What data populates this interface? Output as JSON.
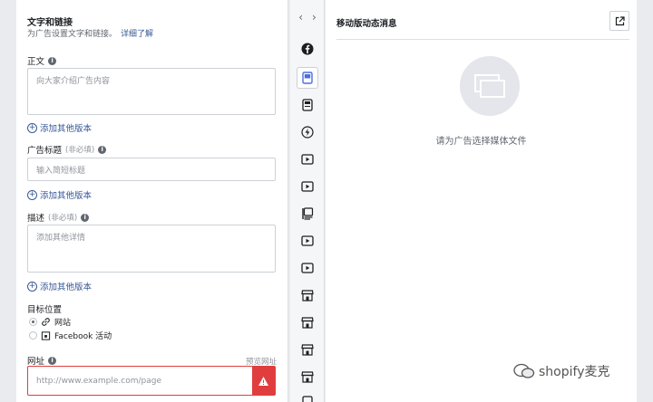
{
  "left": {
    "title": "文字和链接",
    "subtitle": "为广告设置文字和链接。",
    "learn_more": "详细了解",
    "body_label": "正文",
    "body_placeholder": "向大家介绍广告内容",
    "add_version": "添加其他版本",
    "headline_label": "广告标题",
    "headline_optional": "(非必填)",
    "headline_placeholder": "输入简短标题",
    "desc_label": "描述",
    "desc_optional": "(非必填)",
    "desc_placeholder": "添加其他详情",
    "destination_label": "目标位置",
    "dest_website": "网站",
    "dest_facebook": "Facebook 活动",
    "url_label": "网址",
    "preview_url": "预览网址",
    "url_placeholder": "http://www.example.com/page"
  },
  "rail": {
    "prev": "‹",
    "next": "›",
    "icons": [
      "facebook-icon",
      "feed-icon",
      "story-icon",
      "instant-article-icon",
      "video-icon",
      "video-feed-icon",
      "right-column-icon",
      "in-stream-video-icon",
      "suggested-video-icon",
      "marketplace-icon",
      "marketplace-icon-2",
      "marketplace-icon-3",
      "marketplace-icon-4",
      "partial-icon"
    ]
  },
  "right": {
    "title": "移动版动态消息",
    "media_prompt": "请为广告选择媒体文件"
  },
  "watermark": "shopify麦克",
  "colors": {
    "link": "#385898",
    "error": "#e03e3e",
    "active_rail": "#4a6ee0"
  }
}
